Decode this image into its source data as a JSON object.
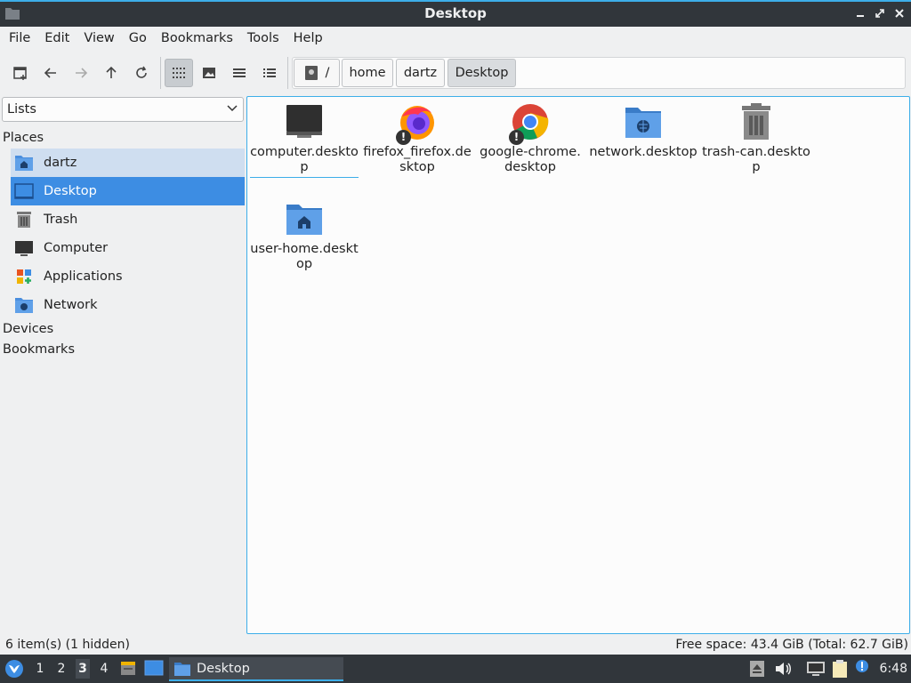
{
  "window": {
    "title": "Desktop"
  },
  "menubar": [
    "File",
    "Edit",
    "View",
    "Go",
    "Bookmarks",
    "Tools",
    "Help"
  ],
  "path": {
    "root": "/",
    "crumbs": [
      "home",
      "dartz",
      "Desktop"
    ]
  },
  "sidebar": {
    "dropdown": "Lists",
    "places_title": "Places",
    "places": [
      "dartz",
      "Desktop",
      "Trash",
      "Computer",
      "Applications",
      "Network"
    ],
    "devices_title": "Devices",
    "bookmarks_title": "Bookmarks"
  },
  "files": [
    {
      "name": "computer.desktop",
      "icon": "monitor-icon"
    },
    {
      "name": "firefox_firefox.desktop",
      "icon": "firefox-icon",
      "badge": "!"
    },
    {
      "name": "google-chrome.desktop",
      "icon": "chrome-icon",
      "badge": "!"
    },
    {
      "name": "network.desktop",
      "icon": "network-folder-icon"
    },
    {
      "name": "trash-can.desktop",
      "icon": "trash-icon"
    },
    {
      "name": "user-home.desktop",
      "icon": "home-folder-icon"
    }
  ],
  "status": {
    "left": "6 item(s) (1 hidden)",
    "right": "Free space: 43.4 GiB (Total: 62.7 GiB)"
  },
  "taskbar": {
    "workspaces": [
      "1",
      "2",
      "3",
      "4"
    ],
    "active_workspace": "3",
    "task": "Desktop",
    "clock": "6:48"
  },
  "colors": {
    "accent": "#3daee9",
    "selection": "#3d8de3",
    "titlebar": "#31363b",
    "folder": "#4a8ede"
  }
}
